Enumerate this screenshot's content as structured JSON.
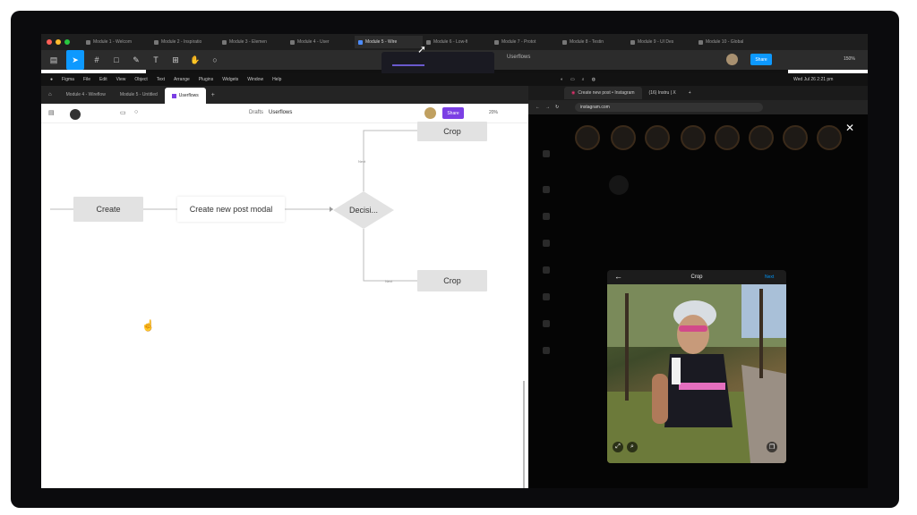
{
  "figma_tabs": {
    "items": [
      {
        "label": "Module 1 - Welcom"
      },
      {
        "label": "Module 2 - Inspiratio"
      },
      {
        "label": "Module 3 - Elemen"
      },
      {
        "label": "Module 4 - User"
      },
      {
        "label": "Module 5 - Wire"
      },
      {
        "label": "Module 6 - Low-fi"
      },
      {
        "label": "Module 7 - Protot"
      },
      {
        "label": "Module 8 - Testin"
      },
      {
        "label": "Module 9 - UI Des"
      },
      {
        "label": "Module 10 - Global"
      }
    ],
    "active_index": 4
  },
  "toolbar": {
    "center_label": "Userflows",
    "share_label": "Share",
    "zoom": "150%"
  },
  "menubar": {
    "items": [
      "Figma",
      "File",
      "Edit",
      "View",
      "Object",
      "Text",
      "Arrange",
      "Plugins",
      "Widgets",
      "Window",
      "Help"
    ],
    "clock": "Wed Jul 26  2:21 pm"
  },
  "figma_window_tabs": [
    {
      "label": "Module 4 - Wireflow"
    },
    {
      "label": "Module 5 - Untitled"
    },
    {
      "label": "Userflows"
    }
  ],
  "canvas": {
    "breadcrumb_drafts": "Drafts",
    "breadcrumb_file": "Userflows",
    "share_label": "Share",
    "zoom": "20%",
    "nodes": {
      "create": "Create",
      "create_modal": "Create new post modal",
      "decision": "Decisi...",
      "crop_top": "Crop",
      "crop_bottom": "Crop"
    },
    "edge_labels": {
      "top": "Next",
      "bottom": "Next"
    }
  },
  "instagram": {
    "tabs": [
      {
        "label": "Create new post • Instagram"
      },
      {
        "label": "(16) Instru | X"
      }
    ],
    "url": "instagram.com",
    "modal_title": "Crop",
    "modal_next": "Next"
  }
}
